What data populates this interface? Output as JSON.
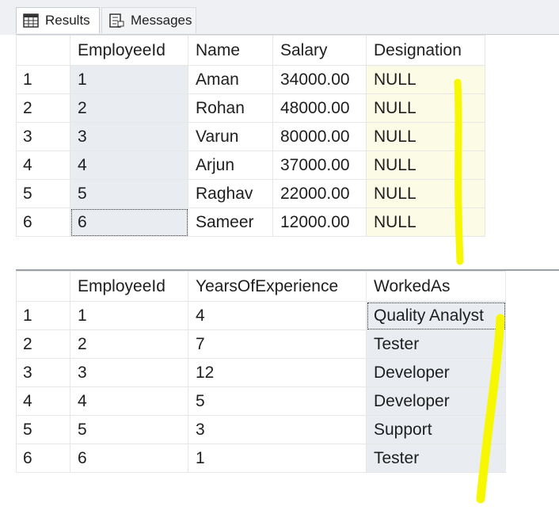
{
  "tabs": {
    "results": "Results",
    "messages": "Messages"
  },
  "result1": {
    "columns": [
      "EmployeeId",
      "Name",
      "Salary",
      "Designation"
    ],
    "rows": [
      [
        "1",
        "1",
        "Aman",
        "34000.00",
        "NULL"
      ],
      [
        "2",
        "2",
        "Rohan",
        "48000.00",
        "NULL"
      ],
      [
        "3",
        "3",
        "Varun",
        "80000.00",
        "NULL"
      ],
      [
        "4",
        "4",
        "Arjun",
        "37000.00",
        "NULL"
      ],
      [
        "5",
        "5",
        "Raghav",
        "22000.00",
        "NULL"
      ],
      [
        "6",
        "6",
        "Sameer",
        "12000.00",
        "NULL"
      ]
    ]
  },
  "result2": {
    "columns": [
      "EmployeeId",
      "YearsOfExperience",
      "WorkedAs"
    ],
    "rows": [
      [
        "1",
        "1",
        "4",
        "Quality Analyst"
      ],
      [
        "2",
        "2",
        "7",
        "Tester"
      ],
      [
        "3",
        "3",
        "12",
        "Developer"
      ],
      [
        "4",
        "4",
        "5",
        "Developer"
      ],
      [
        "5",
        "5",
        "3",
        "Support"
      ],
      [
        "6",
        "6",
        "1",
        "Tester"
      ]
    ]
  },
  "colors": {
    "highlighter": "#f7f700",
    "selected_column": "#e9edf2",
    "designation_column": "#fcfbe6"
  },
  "icons": {
    "results_tab": "grid-icon",
    "messages_tab": "messages-icon"
  }
}
